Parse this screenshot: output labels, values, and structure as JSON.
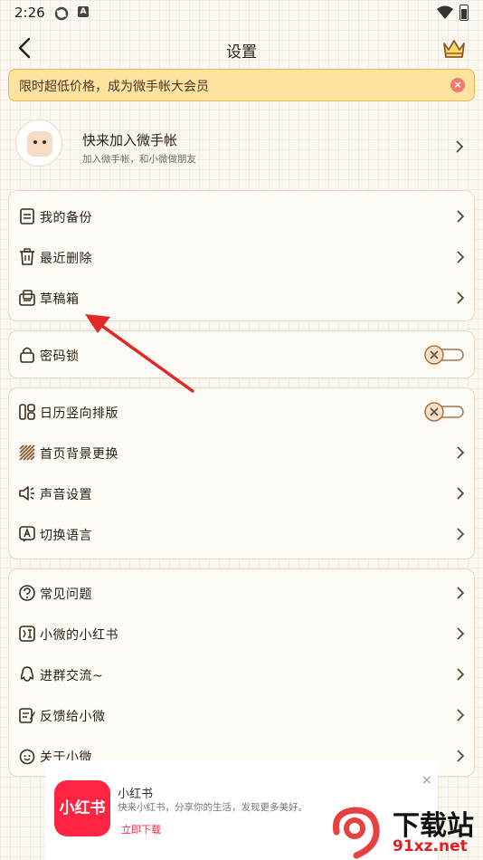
{
  "status": {
    "time": "2:26",
    "icon2": "A"
  },
  "nav": {
    "title": "设置"
  },
  "promo": {
    "text": "限时超低价格，成为微手帐大会员",
    "close": "×"
  },
  "join": {
    "title": "快来加入微手帐",
    "subtitle": "加入微手帐，和小微做朋友"
  },
  "groups": {
    "g1": [
      {
        "label": "我的备份",
        "icon": "backup-icon"
      },
      {
        "label": "最近删除",
        "icon": "trash-icon"
      },
      {
        "label": "草稿箱",
        "icon": "draft-box-icon"
      }
    ],
    "g2": [
      {
        "label": "密码锁",
        "icon": "lock-icon",
        "toggle": false
      }
    ],
    "g3": [
      {
        "label": "日历竖向排版",
        "icon": "calendar-layout-icon",
        "toggle": false
      },
      {
        "label": "首页背景更换",
        "icon": "background-icon"
      },
      {
        "label": "声音设置",
        "icon": "speaker-icon"
      },
      {
        "label": "切换语言",
        "icon": "language-icon"
      }
    ],
    "g4": [
      {
        "label": "常见问题",
        "icon": "question-icon"
      },
      {
        "label": "小微的小红书",
        "icon": "xiaohongshu-icon"
      },
      {
        "label": "进群交流~",
        "icon": "qq-icon"
      },
      {
        "label": "反馈给小微",
        "icon": "feedback-icon"
      },
      {
        "label": "关于小微",
        "icon": "smile-icon"
      }
    ]
  },
  "ad": {
    "logo": "小红书",
    "name": "小红书",
    "description": "快来小红书，分享你的生活，发现更多美好。",
    "button": "立即下载",
    "close": "×"
  },
  "watermark": {
    "text": "下载站",
    "url": "91xz.net"
  },
  "colors": {
    "accent": "#c8875a",
    "promo_bg": "#fde2a0",
    "ad_red": "#ff2442",
    "annotation_arrow": "#e02828"
  }
}
